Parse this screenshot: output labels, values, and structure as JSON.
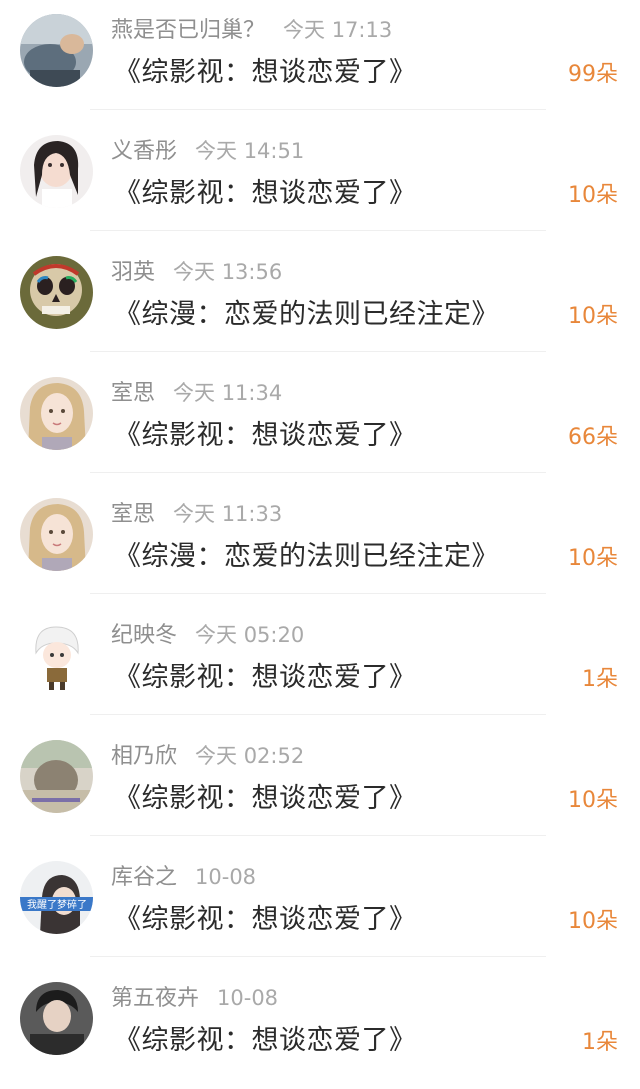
{
  "colors": {
    "name": "#8f8f8f",
    "time": "#a9a9a9",
    "title": "#2b2b2b",
    "count": "#e8873a",
    "divider": "#efefef"
  },
  "entries": [
    {
      "name": "燕是否已归巢？",
      "time": "今天 17:13",
      "title": "《综影视：想谈恋爱了》",
      "count": "99朵"
    },
    {
      "name": "义香彤",
      "time": "今天 14:51",
      "title": "《综影视：想谈恋爱了》",
      "count": "10朵"
    },
    {
      "name": "羽英",
      "time": "今天 13:56",
      "title": "《综漫：恋爱的法则已经注定》",
      "count": "10朵"
    },
    {
      "name": "室思",
      "time": "今天 11:34",
      "title": "《综影视：想谈恋爱了》",
      "count": "66朵"
    },
    {
      "name": "室思",
      "time": "今天 11:33",
      "title": "《综漫：恋爱的法则已经注定》",
      "count": "10朵"
    },
    {
      "name": "纪映冬",
      "time": "今天 05:20",
      "title": "《综影视：想谈恋爱了》",
      "count": "1朵"
    },
    {
      "name": "相乃欣",
      "time": "今天 02:52",
      "title": "《综影视：想谈恋爱了》",
      "count": "10朵"
    },
    {
      "name": "库谷之",
      "time": "10-08",
      "title": "《综影视：想谈恋爱了》",
      "count": "10朵",
      "avatar_caption": "我醒了梦碎了"
    },
    {
      "name": "第五夜卉",
      "time": "10-08",
      "title": "《综影视：想谈恋爱了》",
      "count": "1朵"
    }
  ]
}
